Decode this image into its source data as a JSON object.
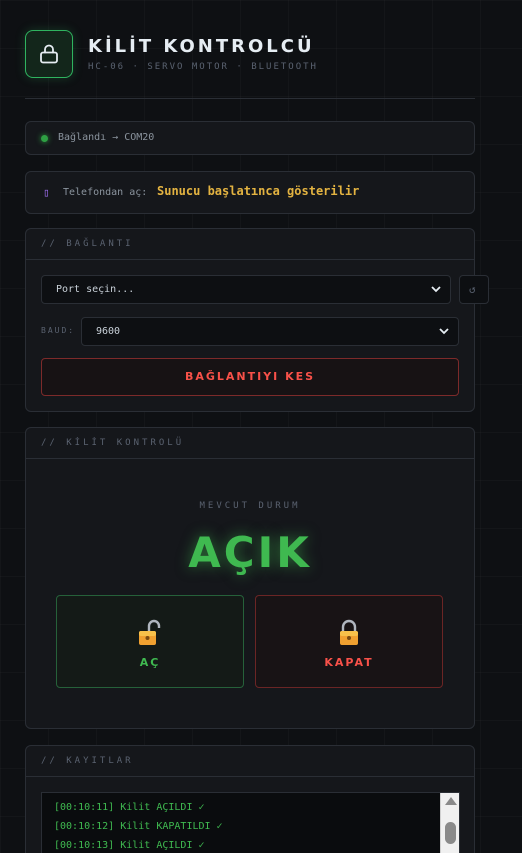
{
  "header": {
    "title": "KİLİT KONTROLCÜ",
    "subtitle": "HC-06 · SERVO MOTOR · BLUETOOTH",
    "icon": "lock-icon"
  },
  "status": {
    "text": "Bağlandı → COM20",
    "color": "#2ea043"
  },
  "phone": {
    "icon": "phone-icon",
    "label": "Telefondan aç:",
    "value": "Sunucu başlatınca gösterilir"
  },
  "connection": {
    "section_title": "// BAĞLANTI",
    "port_placeholder": "Port seçin...",
    "refresh_icon": "refresh-icon",
    "refresh_glyph": "↺",
    "baud_label": "BAUD:",
    "baud_value": "9600",
    "disconnect_label": "BAĞLANTIYI KES"
  },
  "lock_control": {
    "section_title": "// KİLİT KONTROLÜ",
    "state_label": "MEVCUT DURUM",
    "state_value": "AÇIK",
    "open_label": "AÇ",
    "close_label": "KAPAT",
    "open_icon": "unlocked-padlock-icon",
    "close_icon": "locked-padlock-icon"
  },
  "logs": {
    "section_title": "// KAYITLAR",
    "lines": [
      "[00:10:11] Kilit AÇILDI ✓",
      "[00:10:12] Kilit KAPATILDI ✓",
      "[00:10:13] Kilit AÇILDI ✓"
    ]
  },
  "colors": {
    "accent_green": "#3fb950",
    "danger_red": "#f85149",
    "highlight_yellow": "#e3b341"
  }
}
